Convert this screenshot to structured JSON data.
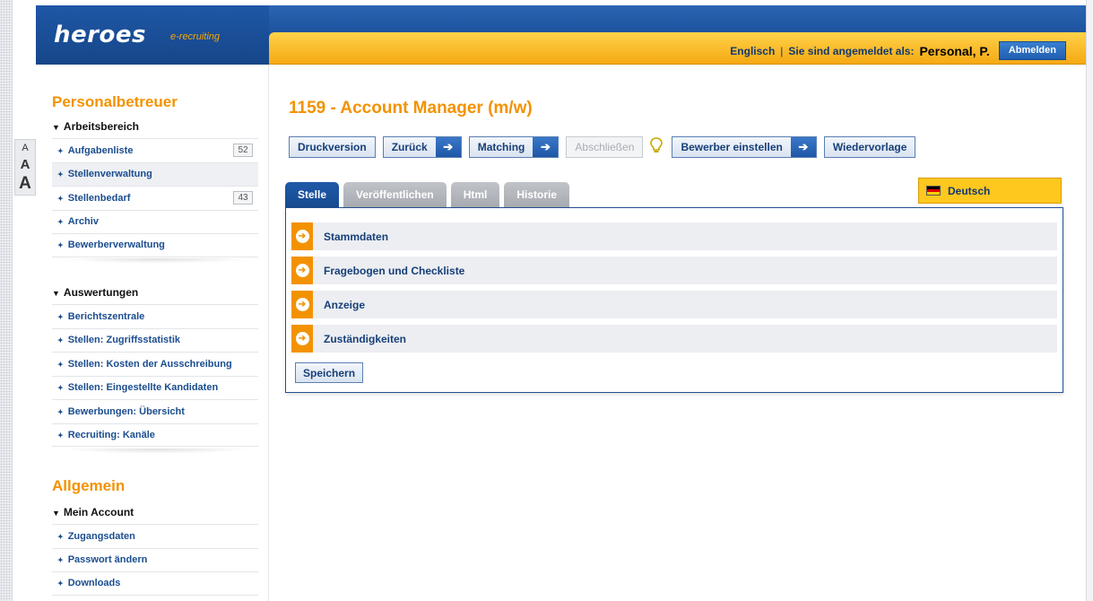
{
  "brand": {
    "logo": "heroes",
    "tagline": "e-recruiting"
  },
  "header": {
    "language_link": "Englisch",
    "separator": "|",
    "logged_in_label": "Sie sind angemeldet als:",
    "user_name": "Personal, P.",
    "logout_label": "Abmelden"
  },
  "font_switch": {
    "small": "A",
    "medium": "A",
    "large": "A"
  },
  "sidebar": {
    "section1_title": "Personalbetreuer",
    "group1": {
      "title": "Arbeitsbereich",
      "items": [
        {
          "label": "Aufgabenliste",
          "badge": "52"
        },
        {
          "label": "Stellenverwaltung",
          "badge": ""
        },
        {
          "label": "Stellenbedarf",
          "badge": "43"
        },
        {
          "label": "Archiv",
          "badge": ""
        },
        {
          "label": "Bewerberverwaltung",
          "badge": ""
        }
      ]
    },
    "group2": {
      "title": "Auswertungen",
      "items": [
        {
          "label": "Berichtszentrale"
        },
        {
          "label": "Stellen: Zugriffsstatistik"
        },
        {
          "label": "Stellen: Kosten der Ausschreibung"
        },
        {
          "label": "Stellen: Eingestellte Kandidaten"
        },
        {
          "label": "Bewerbungen: Übersicht"
        },
        {
          "label": "Recruiting: Kanäle"
        }
      ]
    },
    "section2_title": "Allgemein",
    "group3": {
      "title": "Mein Account",
      "items": [
        {
          "label": "Zugangsdaten"
        },
        {
          "label": "Passwort ändern"
        },
        {
          "label": "Downloads"
        }
      ]
    }
  },
  "main": {
    "title": "1159 - Account Manager (m/w)",
    "toolbar": {
      "print": "Druckversion",
      "back": "Zurück",
      "matching": "Matching",
      "finish": "Abschließen",
      "hire": "Bewerber einstellen",
      "resubmit": "Wiedervorlage"
    },
    "tabs": [
      "Stelle",
      "Veröffentlichen",
      "Html",
      "Historie"
    ],
    "active_tab": "Stelle",
    "language": "Deutsch",
    "sections": [
      "Stammdaten",
      "Fragebogen und Checkliste",
      "Anzeige",
      "Zuständigkeiten"
    ],
    "save_label": "Speichern"
  },
  "colors": {
    "brand_blue": "#1b4f99",
    "accent_orange": "#f39200",
    "header_yellow": "#ffc81f"
  }
}
